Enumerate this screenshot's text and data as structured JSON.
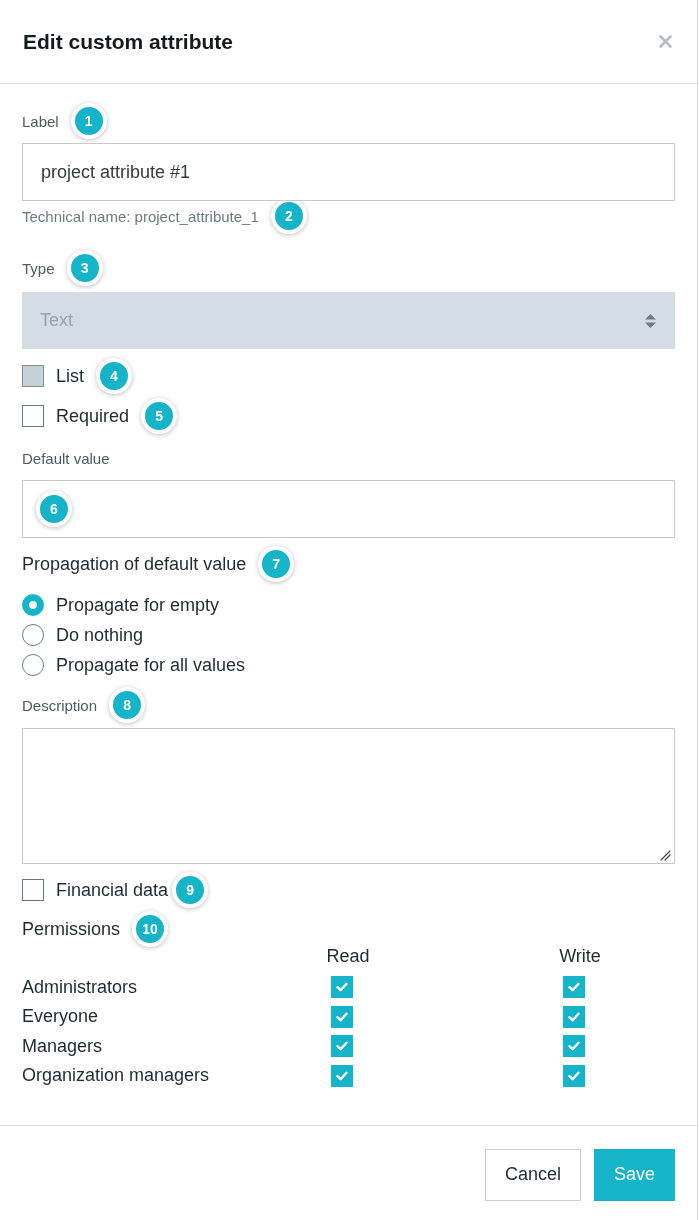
{
  "dialog": {
    "title": "Edit custom attribute"
  },
  "label_field": {
    "label": "Label",
    "marker": "1",
    "value": "project attribute #1",
    "hint": "Technical name: project_attribute_1",
    "hint_marker": "2"
  },
  "type_field": {
    "label": "Type",
    "marker": "3",
    "value": "Text",
    "disabled": true
  },
  "options": [
    {
      "label": "List",
      "marker": "4",
      "checked": false,
      "disabled": true
    },
    {
      "label": "Required",
      "marker": "5",
      "checked": false,
      "disabled": false
    }
  ],
  "default_value_field": {
    "label": "Default value",
    "marker": "6"
  },
  "propagation": {
    "title": "Propagation of default value",
    "marker": "7",
    "choices": [
      {
        "label": "Propagate for empty",
        "selected": true
      },
      {
        "label": "Do nothing",
        "selected": false
      },
      {
        "label": "Propagate for all values",
        "selected": false
      }
    ]
  },
  "description_field": {
    "label": "Description",
    "marker": "8"
  },
  "financial_data": {
    "label": "Financial data",
    "marker": "9",
    "checked": false
  },
  "permissions": {
    "title": "Permissions",
    "marker": "10",
    "columns": [
      "Read",
      "Write"
    ],
    "rows": [
      {
        "group": "Administrators",
        "checked": [
          true,
          true
        ]
      },
      {
        "group": "Everyone",
        "checked": [
          true,
          true
        ]
      },
      {
        "group": "Managers",
        "checked": [
          true,
          true
        ]
      },
      {
        "group": "Organization managers",
        "checked": [
          true,
          true
        ]
      }
    ]
  },
  "buttons": [
    {
      "label": "Cancel",
      "kind": "outline"
    },
    {
      "label": "Save",
      "kind": "filled"
    }
  ]
}
